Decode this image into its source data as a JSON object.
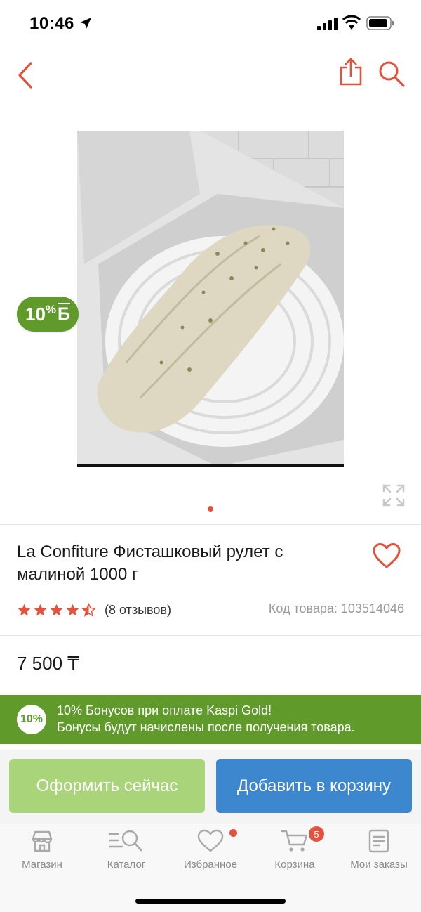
{
  "status_bar": {
    "time": "10:46"
  },
  "product": {
    "title": "La Confiture Фисташковый рулет с малиной 1000 г",
    "bonus_badge_value": "10",
    "bonus_badge_pct": "%",
    "bonus_badge_currency": "Б",
    "rating_stars": 4.5,
    "reviews": "(8 отзывов)",
    "sku": "Код товара: 103514046",
    "price": "7 500 ₸",
    "image_count": 1,
    "active_image": 1
  },
  "promo": {
    "badge": "10%",
    "line1": "10% Бонусов при оплате Kaspi Gold!",
    "line2": "Бонусы будут начислены после получения товара."
  },
  "actions": {
    "checkout_label": "Оформить сейчас",
    "add_to_cart_label": "Добавить в корзину"
  },
  "tabs": [
    {
      "label": "Магазин",
      "icon": "store-icon"
    },
    {
      "label": "Каталог",
      "icon": "catalog-icon"
    },
    {
      "label": "Избранное",
      "icon": "heart-icon"
    },
    {
      "label": "Корзина",
      "icon": "cart-icon"
    },
    {
      "label": "Мои заказы",
      "icon": "orders-icon"
    }
  ],
  "cart_count": "5",
  "colors": {
    "accent": "#e2523d",
    "bonus_green": "#5f9a2b",
    "checkout_button": "#a9d47a",
    "cart_button": "#3d87cf"
  }
}
